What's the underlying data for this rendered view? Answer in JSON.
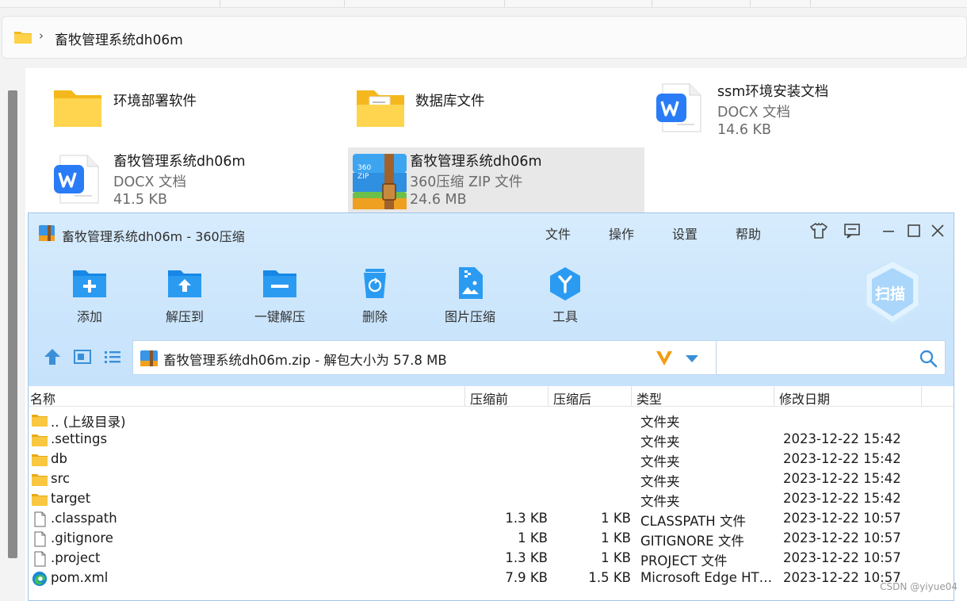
{
  "explorer": {
    "breadcrumb": "畜牧管理系统dh06m",
    "items": [
      {
        "name": "环境部署软件",
        "type": "",
        "size": "",
        "icon": "folder-icon"
      },
      {
        "name": "数据库文件",
        "type": "",
        "size": "",
        "icon": "folder-with-docs-icon"
      },
      {
        "name": "ssm环境安装文档",
        "type": "DOCX 文档",
        "size": "14.6 KB",
        "icon": "wps-writer-icon"
      },
      {
        "name": "畜牧管理系统dh06m",
        "type": "DOCX 文档",
        "size": "41.5 KB",
        "icon": "wps-writer-icon"
      },
      {
        "name": "畜牧管理系统dh06m",
        "type": "360压缩 ZIP 文件",
        "size": "24.6 MB",
        "icon": "360zip-archive-icon"
      }
    ]
  },
  "zip_window": {
    "title": "畜牧管理系统dh06m - 360压缩",
    "menu": [
      "文件",
      "操作",
      "设置",
      "帮助"
    ],
    "toolbar": [
      "添加",
      "解压到",
      "一键解压",
      "删除",
      "图片压缩",
      "工具"
    ],
    "scan_label": "扫描",
    "path_text": "畜牧管理系统dh06m.zip - 解包大小为 57.8 MB",
    "search_placeholder": "",
    "columns": [
      "名称",
      "压缩前",
      "压缩后",
      "类型",
      "修改日期"
    ],
    "rows": [
      {
        "name": ".. (上级目录)",
        "before": "",
        "after": "",
        "type": "文件夹",
        "date": "",
        "icon": "folder-icon"
      },
      {
        "name": ".settings",
        "before": "",
        "after": "",
        "type": "文件夹",
        "date": "2023-12-22 15:42",
        "icon": "folder-icon"
      },
      {
        "name": "db",
        "before": "",
        "after": "",
        "type": "文件夹",
        "date": "2023-12-22 15:42",
        "icon": "folder-icon"
      },
      {
        "name": "src",
        "before": "",
        "after": "",
        "type": "文件夹",
        "date": "2023-12-22 15:42",
        "icon": "folder-icon"
      },
      {
        "name": "target",
        "before": "",
        "after": "",
        "type": "文件夹",
        "date": "2023-12-22 15:42",
        "icon": "folder-icon"
      },
      {
        "name": ".classpath",
        "before": "1.3 KB",
        "after": "1 KB",
        "type": "CLASSPATH 文件",
        "date": "2023-12-22 10:57",
        "icon": "file-icon"
      },
      {
        "name": ".gitignore",
        "before": "1 KB",
        "after": "1 KB",
        "type": "GITIGNORE 文件",
        "date": "2023-12-22 10:57",
        "icon": "file-icon"
      },
      {
        "name": ".project",
        "before": "1.3 KB",
        "after": "1 KB",
        "type": "PROJECT 文件",
        "date": "2023-12-22 10:57",
        "icon": "file-icon"
      },
      {
        "name": "pom.xml",
        "before": "7.9 KB",
        "after": "1.5 KB",
        "type": "Microsoft Edge HT…",
        "date": "2023-12-22 10:57",
        "icon": "edge-icon"
      }
    ]
  },
  "watermark": "CSDN @yiyue04",
  "colors": {
    "accent": "#1a8cff",
    "header_bg": "#cfe7fc",
    "folder": "#f7c948"
  }
}
